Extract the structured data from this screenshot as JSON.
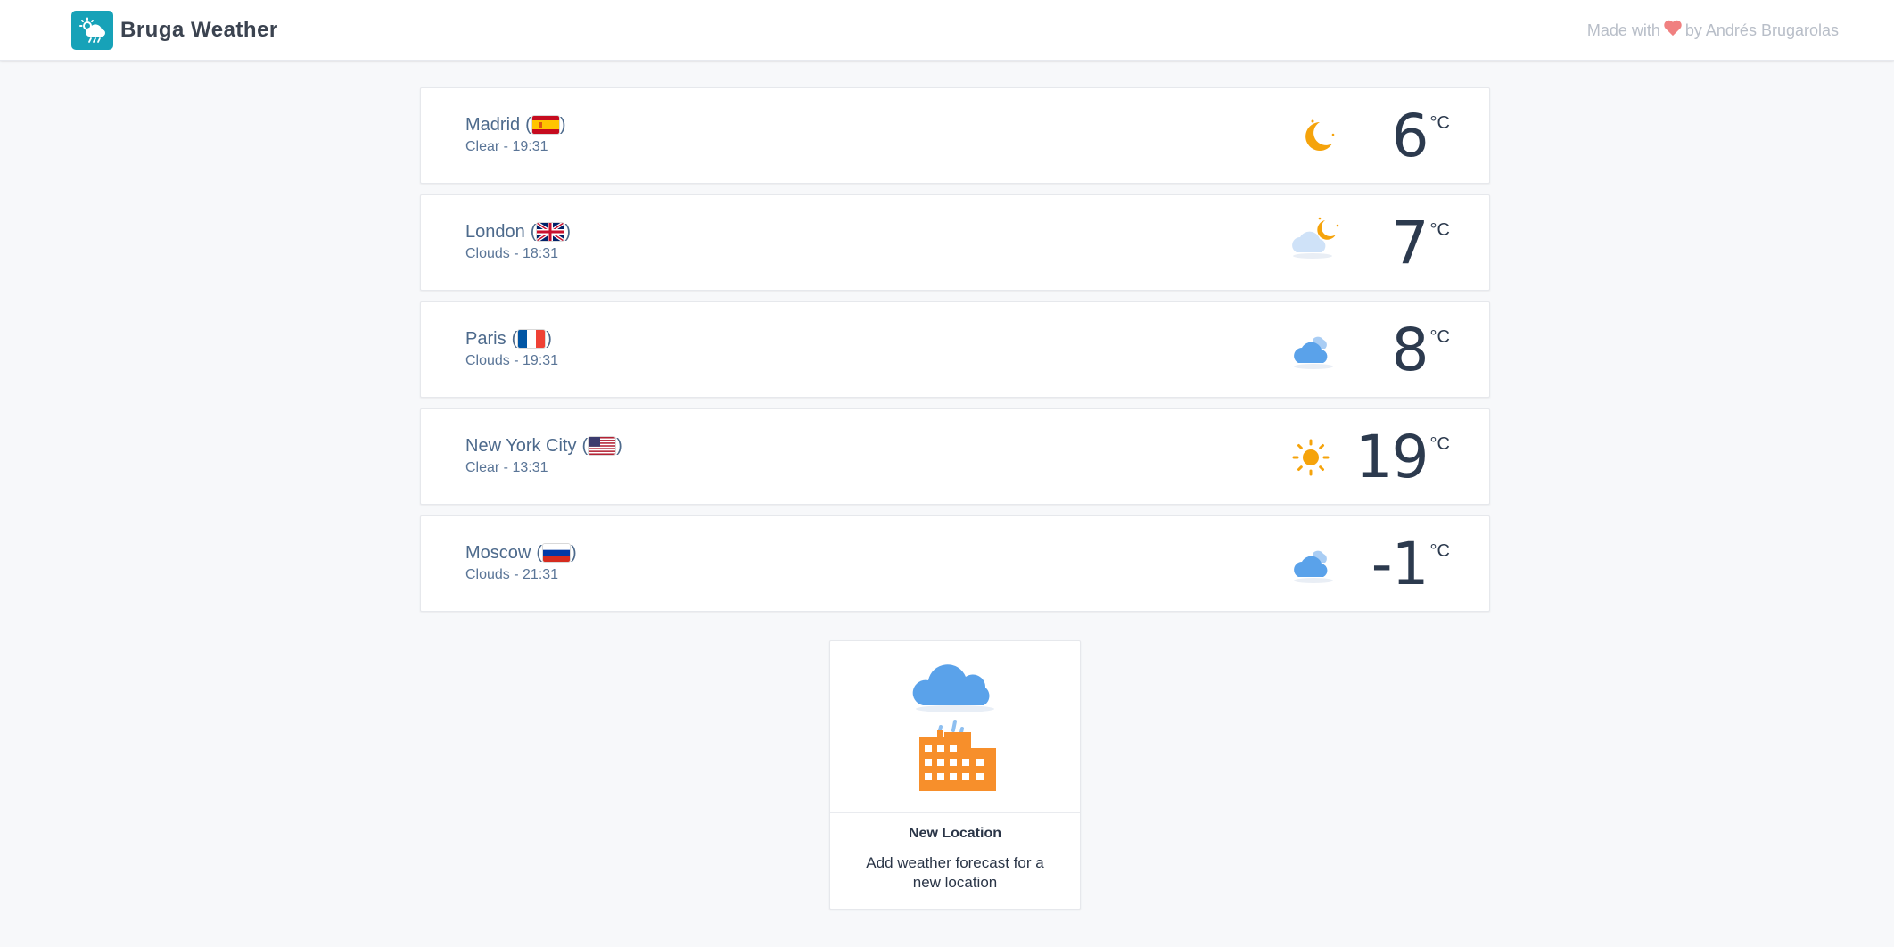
{
  "app": {
    "title": "Bruga Weather",
    "credits_prefix": "Made with",
    "credits_suffix": "by Andrés Brugarolas",
    "brand_color": "#17a2b8",
    "heart_color": "#f08080"
  },
  "locations": [
    {
      "city": "Madrid",
      "country_flag": "spain-flag",
      "condition": "Clear",
      "time": "19:31",
      "subtitle": "Clear - 19:31",
      "icon": "moon-icon",
      "temp": "6",
      "unit": "°C"
    },
    {
      "city": "London",
      "country_flag": "uk-flag",
      "condition": "Clouds",
      "time": "18:31",
      "subtitle": "Clouds - 18:31",
      "icon": "cloud-moon-icon",
      "temp": "7",
      "unit": "°C"
    },
    {
      "city": "Paris",
      "country_flag": "france-flag",
      "condition": "Clouds",
      "time": "19:31",
      "subtitle": "Clouds - 19:31",
      "icon": "cloud-icon",
      "temp": "8",
      "unit": "°C"
    },
    {
      "city": "New York City",
      "country_flag": "usa-flag",
      "condition": "Clear",
      "time": "13:31",
      "subtitle": "Clear - 13:31",
      "icon": "sun-icon",
      "temp": "19",
      "unit": "°C"
    },
    {
      "city": "Moscow",
      "country_flag": "russia-flag",
      "condition": "Clouds",
      "time": "21:31",
      "subtitle": "Clouds - 21:31",
      "icon": "cloud-icon",
      "temp": "-1",
      "unit": "°C"
    }
  ],
  "new_location": {
    "title": "New Location",
    "description": "Add weather forecast for a new location",
    "icon": "city-rain-icon"
  },
  "colors": {
    "text_primary": "#2c3a4e",
    "text_link": "#4d6a8c",
    "sun": "#f5a30b",
    "cloud": "#5aa2ea",
    "building": "#f78f2b"
  }
}
